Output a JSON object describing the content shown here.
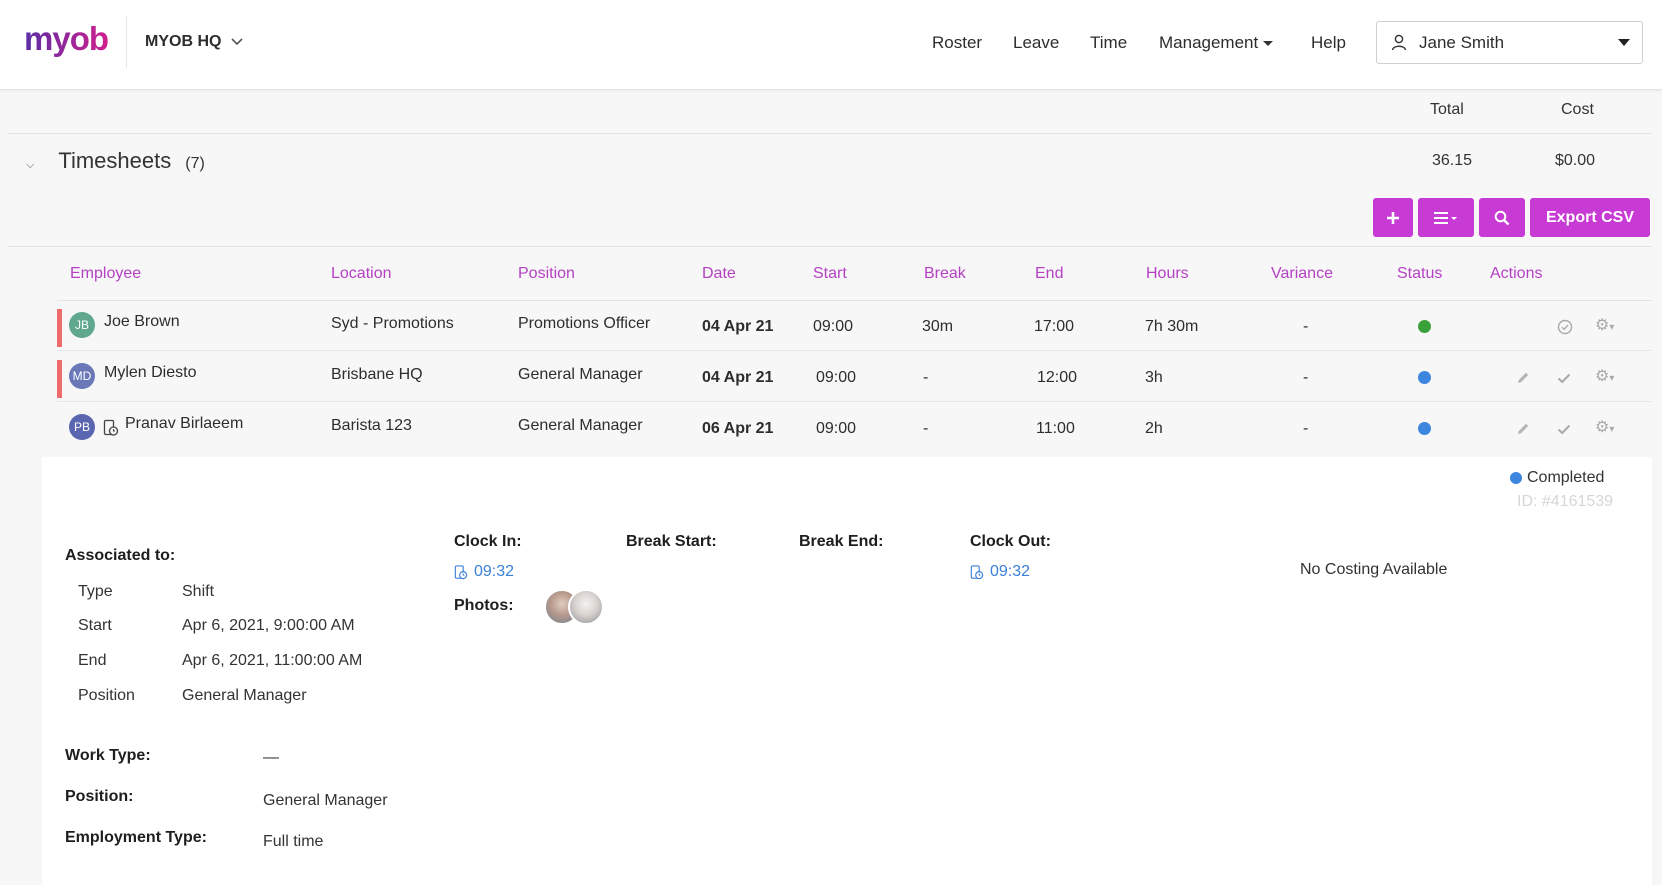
{
  "header": {
    "logo": "myob",
    "org": "MYOB HQ",
    "nav": [
      "Roster",
      "Leave",
      "Time",
      "Management",
      "Help"
    ],
    "user": "Jane Smith"
  },
  "summary": {
    "total_label": "Total",
    "cost_label": "Cost",
    "total_value": "36.15",
    "cost_value": "$0.00"
  },
  "timesheets": {
    "title": "Timesheets",
    "count": "(7)",
    "export_label": "Export CSV"
  },
  "table": {
    "headers": [
      "Employee",
      "Location",
      "Position",
      "Date",
      "Start",
      "Break",
      "End",
      "Hours",
      "Variance",
      "Status",
      "Actions"
    ],
    "rows": [
      {
        "initials": "JB",
        "avatar_color": "#5fa88e",
        "name": "Joe Brown",
        "location": "Syd - Promotions",
        "position": "Promotions Officer",
        "date": "04 Apr 21",
        "start": "09:00",
        "break": "30m",
        "end": "17:00",
        "hours": "7h 30m",
        "variance": "-",
        "status_color": "#3aa13a"
      },
      {
        "initials": "MD",
        "avatar_color": "#6a78b8",
        "name": "Mylen Diesto",
        "location": "Brisbane HQ",
        "position": "General Manager",
        "date": "04 Apr 21",
        "start": "09:00",
        "break": "-",
        "end": "12:00",
        "hours": "3h",
        "variance": "-",
        "status_color": "#3d86e0"
      },
      {
        "initials": "PB",
        "avatar_color": "#5b66b0",
        "name": "Pranav Birlaeem",
        "location": "Barista 123",
        "position": "General Manager",
        "date": "06 Apr 21",
        "start": "09:00",
        "break": "-",
        "end": "11:00",
        "hours": "2h",
        "variance": "-",
        "status_color": "#3d86e0"
      }
    ]
  },
  "detail": {
    "status": "Completed",
    "id": "ID: #4161539",
    "associated_label": "Associated to:",
    "assoc": [
      {
        "k": "Type",
        "v": "Shift"
      },
      {
        "k": "Start",
        "v": "Apr 6, 2021, 9:00:00 AM"
      },
      {
        "k": "End",
        "v": "Apr 6, 2021, 11:00:00 AM"
      },
      {
        "k": "Position",
        "v": "General Manager"
      }
    ],
    "clock_in_label": "Clock In:",
    "clock_in": "09:32",
    "break_start_label": "Break Start:",
    "break_end_label": "Break End:",
    "clock_out_label": "Clock Out:",
    "clock_out": "09:32",
    "photos_label": "Photos:",
    "costing": "No Costing Available",
    "work_type_label": "Work Type:",
    "work_type": "—",
    "position_label": "Position:",
    "position": "General Manager",
    "employment_label": "Employment Type:",
    "employment": "Full time"
  },
  "colors": {
    "accent": "#c73ad4",
    "header_text": "#b540c4",
    "link": "#3a7fd8"
  }
}
